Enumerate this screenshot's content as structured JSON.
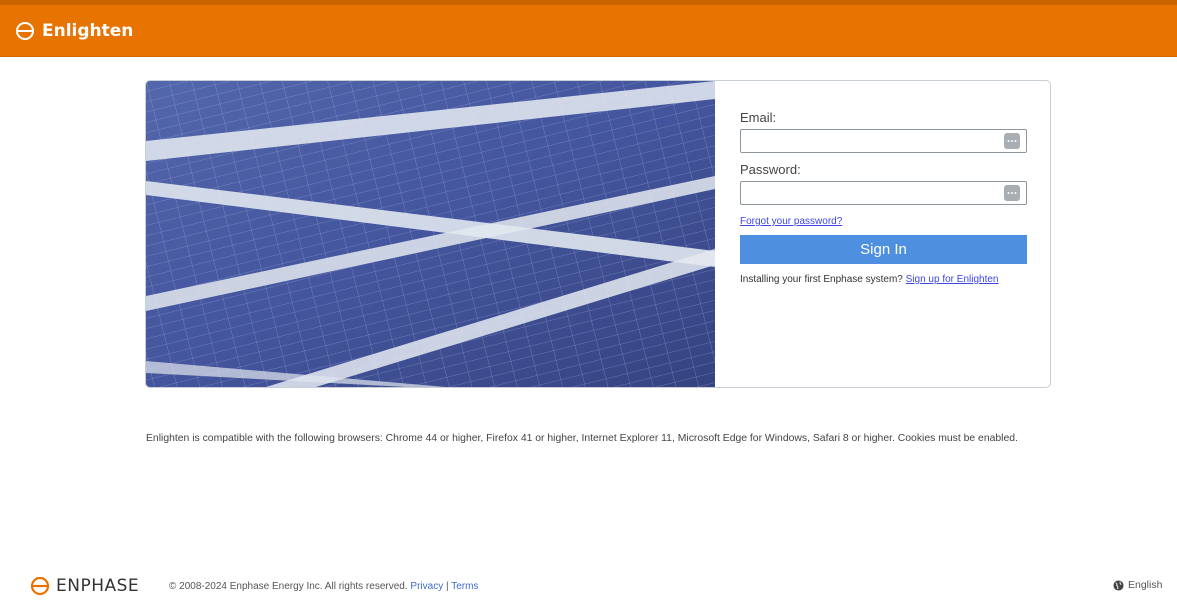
{
  "header": {
    "brand": "Enlighten"
  },
  "login": {
    "email_label": "Email:",
    "email_value": "",
    "password_label": "Password:",
    "password_value": "",
    "forgot_link": "Forgot your password?",
    "signin_button": "Sign In",
    "install_text": "Installing your first Enphase system?",
    "signup_link": "Sign up for Enlighten"
  },
  "compat_notice": "Enlighten is compatible with the following browsers: Chrome 44 or higher, Firefox 41 or higher, Internet Explorer 11, Microsoft Edge for Windows, Safari 8 or higher. Cookies must be enabled.",
  "footer": {
    "logo_text": "ENPHASE",
    "copyright": "© 2008-2024 Enphase Energy Inc. All rights reserved.",
    "privacy": "Privacy",
    "separator": "|",
    "terms": "Terms",
    "language": "English"
  },
  "colors": {
    "accent": "#e77300",
    "button": "#4e8fe0",
    "link": "#3f46e6"
  },
  "icons": [
    "enphase-logo-icon",
    "password-manager-icon",
    "globe-icon"
  ]
}
